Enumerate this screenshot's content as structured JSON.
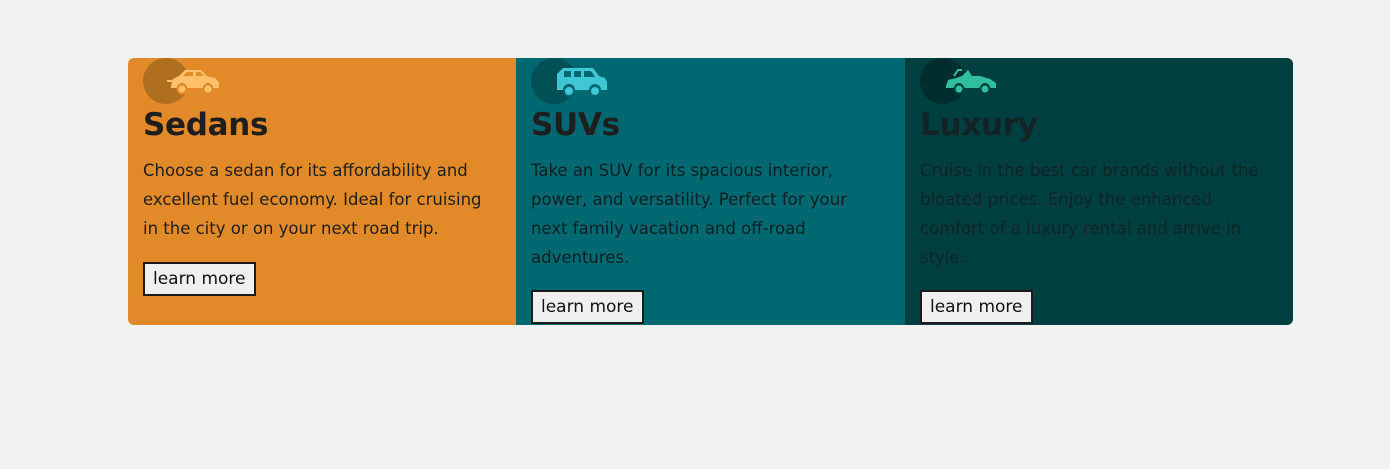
{
  "cards": [
    {
      "title": "Sedans",
      "description": "Choose a sedan for its affordability and excellent fuel economy. Ideal for cruising in the city or on your next road trip.",
      "button_label": "learn more",
      "icon": "sedan-car-icon",
      "bg_color": "#e28a29",
      "icon_color": "#ffc069"
    },
    {
      "title": "SUVs",
      "description": "Take an SUV for its spacious interior, power, and versatility. Perfect for your next family vacation and off-road adventures.",
      "button_label": "learn more",
      "icon": "suv-car-icon",
      "bg_color": "#006870",
      "icon_color": "#3fc7d3"
    },
    {
      "title": "Luxury",
      "description": "Cruise in the best car brands without the bloated prices. Enjoy the enhanced comfort of a luxury rental and arrive in style.",
      "button_label": "learn more",
      "icon": "luxury-car-icon",
      "bg_color": "#003f3f",
      "icon_color": "#2fbf9e"
    }
  ]
}
